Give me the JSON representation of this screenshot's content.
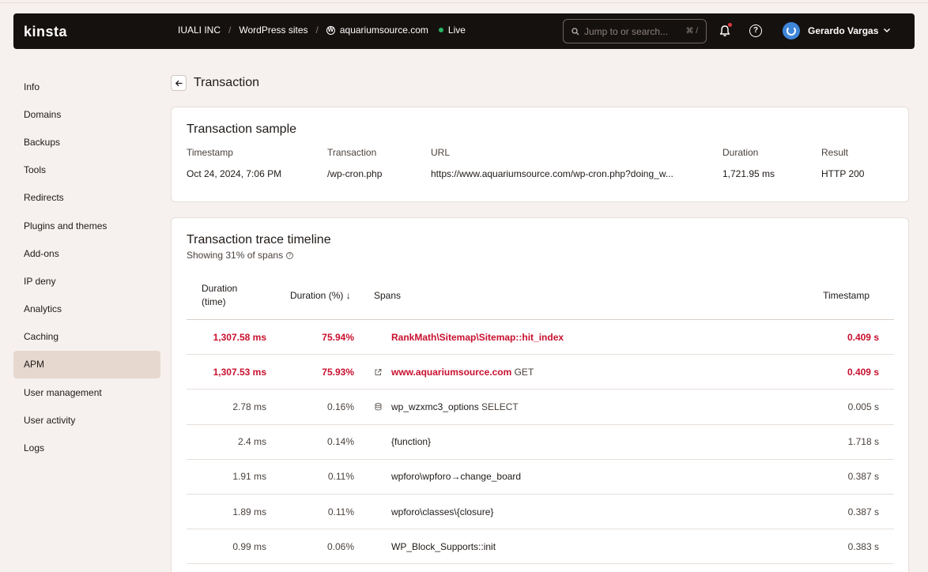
{
  "header": {
    "logo": "kinsta",
    "breadcrumbs": [
      "IUALI INC",
      "WordPress sites",
      "aquariumsource.com"
    ],
    "status": "Live",
    "search_placeholder": "Jump to or search...",
    "search_shortcut": "⌘ /",
    "user_name": "Gerardo Vargas",
    "colors": {
      "bar": "#15110f",
      "live": "#28b463",
      "notification": "#e0383e",
      "avatar": "#3f86d9"
    }
  },
  "sidebar": {
    "items": [
      {
        "label": "Info"
      },
      {
        "label": "Domains"
      },
      {
        "label": "Backups"
      },
      {
        "label": "Tools"
      },
      {
        "label": "Redirects"
      },
      {
        "label": "Plugins and themes"
      },
      {
        "label": "Add-ons"
      },
      {
        "label": "IP deny"
      },
      {
        "label": "Analytics"
      },
      {
        "label": "Caching"
      },
      {
        "label": "APM",
        "active": true
      },
      {
        "label": "User management"
      },
      {
        "label": "User activity"
      },
      {
        "label": "Logs"
      }
    ]
  },
  "page": {
    "title": "Transaction"
  },
  "sample": {
    "title": "Transaction sample",
    "labels": {
      "timestamp": "Timestamp",
      "transaction": "Transaction",
      "url": "URL",
      "duration": "Duration",
      "result": "Result"
    },
    "values": {
      "timestamp": "Oct 24, 2024, 7:06 PM",
      "transaction": "/wp-cron.php",
      "url": "https://www.aquariumsource.com/wp-cron.php?doing_w...",
      "duration": "1,721.95 ms",
      "result": "HTTP 200"
    }
  },
  "trace": {
    "title": "Transaction trace timeline",
    "subtitle": "Showing 31% of spans",
    "columns": {
      "duration_time_line1": "Duration",
      "duration_time_line2": "(time)",
      "duration_pct": "Duration (%) ↓",
      "spans": "Spans",
      "timestamp": "Timestamp"
    },
    "rows": [
      {
        "duration": "1,307.58 ms",
        "pct": "75.94%",
        "span": "RankMath\\Sitemap\\Sitemap::hit_index",
        "method": "",
        "icon": "",
        "ts": "0.409 s",
        "hot": true
      },
      {
        "duration": "1,307.53 ms",
        "pct": "75.93%",
        "span": "www.aquariumsource.com",
        "method": " GET",
        "icon": "external-link-icon",
        "ts": "0.409 s",
        "hot": true
      },
      {
        "duration": "2.78 ms",
        "pct": "0.16%",
        "span": "wp_wzxmc3_options",
        "method": " SELECT",
        "icon": "database-icon",
        "ts": "0.005 s",
        "hot": false
      },
      {
        "duration": "2.4 ms",
        "pct": "0.14%",
        "span": "{function}",
        "method": "",
        "icon": "",
        "ts": "1.718 s",
        "hot": false
      },
      {
        "duration": "1.91 ms",
        "pct": "0.11%",
        "span": "wpforo\\wpforo→change_board",
        "method": "",
        "icon": "",
        "ts": "0.387 s",
        "hot": false
      },
      {
        "duration": "1.89 ms",
        "pct": "0.11%",
        "span": "wpforo\\classes\\{closure}",
        "method": "",
        "icon": "",
        "ts": "0.387 s",
        "hot": false
      },
      {
        "duration": "0.99 ms",
        "pct": "0.06%",
        "span": "WP_Block_Supports::init",
        "method": "",
        "icon": "",
        "ts": "0.383 s",
        "hot": false
      }
    ],
    "hot_color": "#c8102e"
  }
}
